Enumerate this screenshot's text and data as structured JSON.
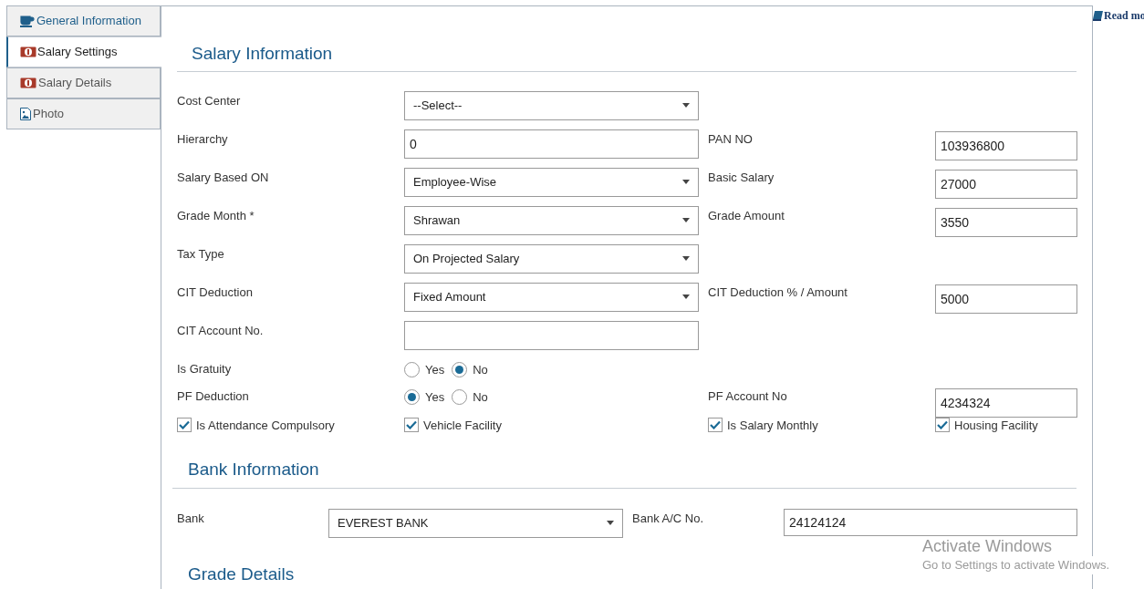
{
  "tabs": [
    {
      "label": "General Information",
      "kind": "cup",
      "selected": false
    },
    {
      "label": "Salary Settings",
      "kind": "money",
      "selected": true
    },
    {
      "label": "Salary Details",
      "kind": "money",
      "selected": false
    },
    {
      "label": "Photo",
      "kind": "image",
      "selected": false
    }
  ],
  "read_more": "Read mo",
  "salary_information": {
    "title": "Salary Information",
    "rows": [
      {
        "left": {
          "label": "Cost Center",
          "kind": "select",
          "value": "--Select--"
        },
        "right": null
      },
      {
        "left": {
          "label": "Hierarchy",
          "kind": "text",
          "value": "0"
        },
        "right": {
          "label": "PAN NO",
          "kind": "text",
          "value": "103936800"
        }
      },
      {
        "left": {
          "label": "Salary Based ON",
          "kind": "select",
          "value": "Employee-Wise"
        },
        "right": {
          "label": "Basic Salary",
          "kind": "text",
          "value": "27000"
        }
      },
      {
        "left": {
          "label": "Grade Month *",
          "kind": "select",
          "value": "Shrawan"
        },
        "right": {
          "label": "Grade Amount",
          "kind": "text",
          "value": "3550"
        }
      },
      {
        "left": {
          "label": "Tax Type",
          "kind": "select",
          "value": "On Projected Salary"
        },
        "right": null
      },
      {
        "left": {
          "label": "CIT Deduction",
          "kind": "select",
          "value": "Fixed Amount"
        },
        "right": {
          "label": "CIT Deduction % / Amount",
          "kind": "text",
          "value": "5000"
        }
      },
      {
        "left": {
          "label": "CIT Account No.",
          "kind": "text"
        },
        "right": null
      },
      {
        "left": {
          "label": "Is Gratuity",
          "kind": "radio",
          "options": [
            {
              "label": "Yes",
              "selected": false
            },
            {
              "label": "No",
              "selected": true
            }
          ]
        },
        "right": null
      },
      {
        "left": {
          "label": "PF Deduction",
          "kind": "radio",
          "options": [
            {
              "label": "Yes",
              "selected": true
            },
            {
              "label": "No",
              "selected": false
            }
          ]
        },
        "right": {
          "label": "PF Account No",
          "kind": "text",
          "value": "4234324"
        }
      }
    ],
    "checkboxes": [
      {
        "label": "Is Attendance Compulsory",
        "checked": true
      },
      {
        "label": "Vehicle Facility",
        "checked": true
      },
      {
        "label": "Is Salary Monthly",
        "checked": true
      },
      {
        "label": "Housing Facility",
        "checked": true
      }
    ]
  },
  "bank_information": {
    "title": "Bank Information",
    "bank_label": "Bank",
    "bank": "EVEREST BANK",
    "account_label": "Bank A/C No.",
    "account": "24124124"
  },
  "grade_details": {
    "title": "Grade Details"
  },
  "windows_notice": {
    "title": "Activate Windows",
    "text": "Go to Settings to activate Windows."
  }
}
